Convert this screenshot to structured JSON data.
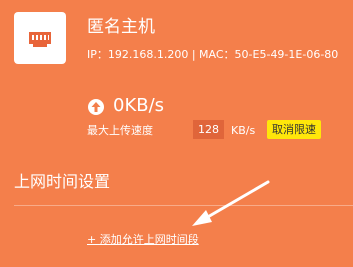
{
  "device": {
    "icon": "ethernet-port-icon",
    "name": "匿名主机",
    "address": "IP：192.168.1.200 | MAC：50-E5-49-1E-06-80"
  },
  "speed": {
    "icon": "arrow-up-circle-icon",
    "value": "0KB/s",
    "limit_label": "最大上传速度",
    "limit_value": "128",
    "limit_unit": "KB/s",
    "cancel_label": "取消限速"
  },
  "online_time": {
    "title": "上网时间设置",
    "add_link": "+ 添加允许上网时间段"
  },
  "colors": {
    "background": "#f47f4b",
    "input_bg": "#e0653a",
    "button_bg": "#ffe60a"
  }
}
